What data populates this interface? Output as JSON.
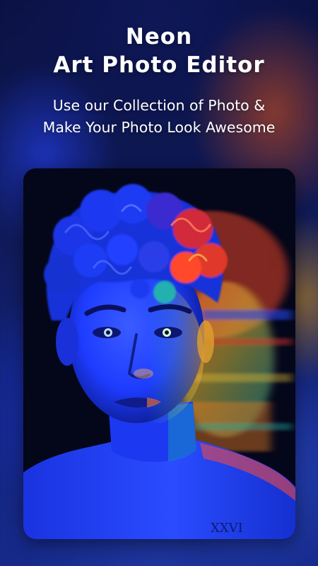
{
  "header": {
    "title_line1": "Neon",
    "title_line2": "Art Photo Editor",
    "subtitle_line1": "Use our Collection of Photo &",
    "subtitle_line2": "Make Your Photo Look Awesome"
  },
  "photo": {
    "subject": "neon-portrait",
    "colors": {
      "blue": "#1e3cff",
      "deep_blue": "#0b1a8c",
      "red": "#ff3a2a",
      "orange": "#ff8a1e",
      "yellow": "#ffd23a",
      "teal": "#23c8b4",
      "background": "#04061a"
    }
  },
  "theme": {
    "text_color": "#ffffff",
    "background_color": "#13206a"
  }
}
